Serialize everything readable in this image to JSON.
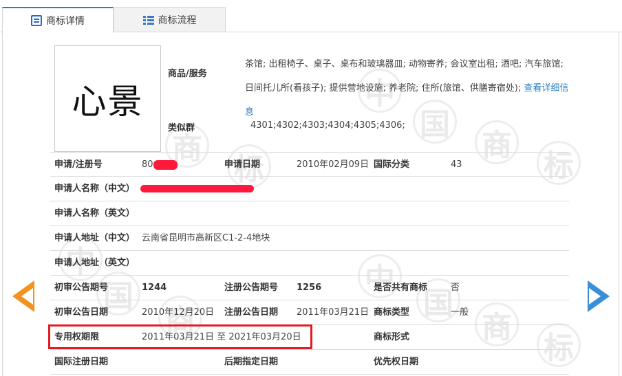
{
  "tabs": {
    "detail": "商标详情",
    "flow": "商标流程"
  },
  "watermark": {
    "chars": [
      "中",
      "国",
      "商",
      "标"
    ]
  },
  "trademark": {
    "logo_text": "心景",
    "goods_label": "商品/服务",
    "goods_text": "茶馆; 出租椅子、桌子、桌布和玻璃器皿; 动物寄养; 会议室出租; 酒吧; 汽车旅馆; 日间托儿所(看孩子); 提供营地设施; 养老院; 住所(旅馆、供膳寄宿处);",
    "goods_link": "查看详细信息",
    "similar_label": "类似群",
    "similar_value": "4301;4302;4303;4304;4305;4306;"
  },
  "details": {
    "reg_no_label": "申请/注册号",
    "reg_no_value": "80",
    "apply_date_label": "申请日期",
    "apply_date_value": "2010年02月09日",
    "intl_class_label": "国际分类",
    "intl_class_value": "43",
    "applicant_cn_label": "申请人名称（中文）",
    "applicant_en_label": "申请人名称（英文）",
    "address_cn_label": "申请人地址（中文）",
    "address_cn_value": "云南省昆明市高新区C1-2-4地块",
    "address_en_label": "申请人地址（英文）",
    "prelim_no_label": "初审公告期号",
    "prelim_no_value": "1244",
    "reg_notice_no_label": "注册公告期号",
    "reg_notice_no_value": "1256",
    "shared_label": "是否共有商标",
    "shared_value": "否",
    "prelim_date_label": "初审公告日期",
    "prelim_date_value": "2010年12月20日",
    "reg_notice_date_label": "注册公告日期",
    "reg_notice_date_value": "2011年03月21日",
    "tm_type_label": "商标类型",
    "tm_type_value": "一般",
    "exclusive_label": "专用权期限",
    "exclusive_value": "2011年03月21日 至 2021年03月20日",
    "tm_form_label": "商标形式",
    "intl_reg_date_label": "国际注册日期",
    "later_date_label": "后期指定日期",
    "priority_date_label": "优先权日期"
  },
  "colors": {
    "accent": "#2a7bc8",
    "highlight": "#e31b23",
    "arrow_left": "#f29320",
    "arrow_right": "#3b8fd6",
    "redaction": "#ff1a3c"
  }
}
